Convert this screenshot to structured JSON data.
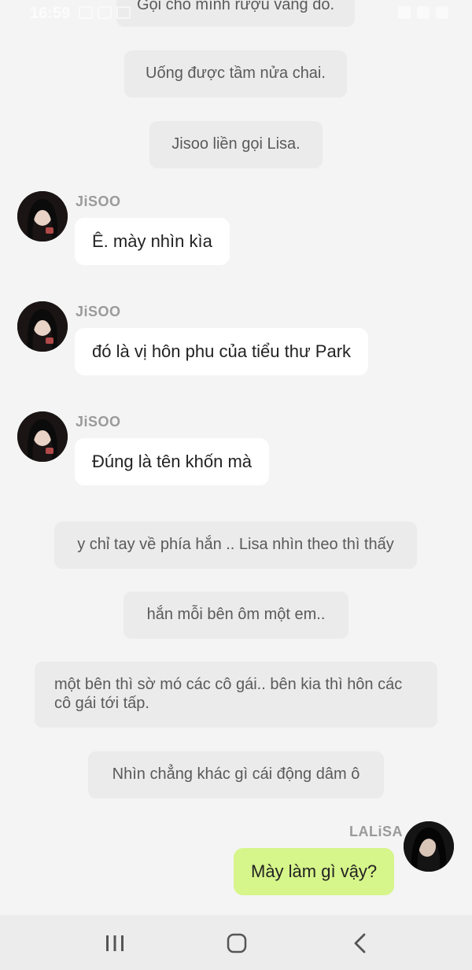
{
  "status_bar": {
    "time": "16:59"
  },
  "narrations": [
    {
      "text": "Gọi cho mình rượu vang đỏ."
    },
    {
      "text": "Uống được tầm nửa chai."
    },
    {
      "text": "Jisoo liền gọi Lisa."
    },
    {
      "text": "y chỉ tay về phía hắn .. Lisa nhìn theo thì thấy"
    },
    {
      "text": "hắn mỗi bên ôm một em.."
    },
    {
      "text": "một bên thì sờ mó các cô gái.. bên kia thì hôn các cô gái tới tấp."
    },
    {
      "text": "Nhìn chẳng khác gì cái động dâm ô"
    }
  ],
  "messages": [
    {
      "sender": "JiSOO",
      "text": "Ê. mày nhìn kìa"
    },
    {
      "sender": "JiSOO",
      "text": "đó là vị hôn phu của tiểu thư Park"
    },
    {
      "sender": "JiSOO",
      "text": "Đúng là tên khốn mà"
    },
    {
      "sender": "LALiSA",
      "text": "Mày làm gì vậy?"
    }
  ],
  "colors": {
    "background": "#f4f4f4",
    "narration_bg": "#ebebeb",
    "incoming_bubble": "#ffffff",
    "outgoing_bubble": "#d6f58a",
    "sender_name": "#9a9a9a"
  },
  "nav": {
    "recent_icon": "recent-apps-icon",
    "home_icon": "home-icon",
    "back_icon": "back-icon"
  }
}
